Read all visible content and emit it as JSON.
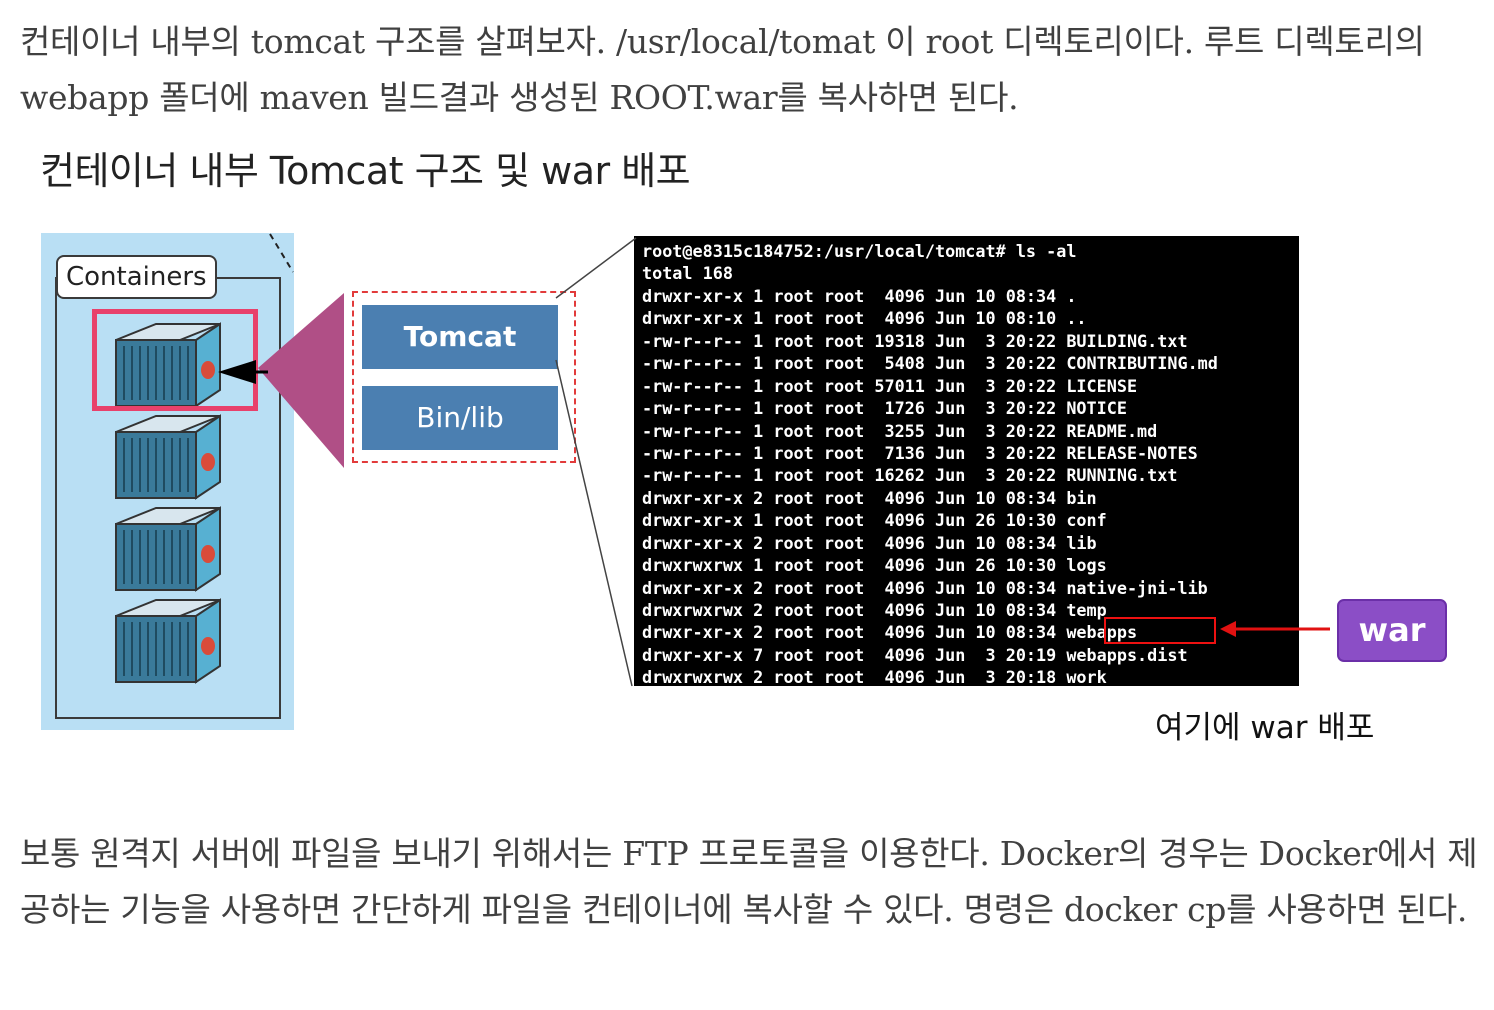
{
  "intro": "컨테이너 내부의  tomcat 구조를 살펴보자.  /usr/local/tomat 이 root 디렉토리이다. 루트 디렉토리의   webapp 폴더에 maven 빌드결과 생성된 ROOT.war를 복사하면 된다.",
  "figure": {
    "title": "컨테이너 내부 Tomcat 구조 및 war 배포",
    "containers_label": "Containers",
    "tomcat_block": "Tomcat",
    "binlib_block": "Bin/lib",
    "terminal_lines": [
      "root@e8315c184752:/usr/local/tomcat# ls -al",
      "total 168",
      "drwxr-xr-x 1 root root  4096 Jun 10 08:34 .",
      "drwxr-xr-x 1 root root  4096 Jun 10 08:10 ..",
      "-rw-r--r-- 1 root root 19318 Jun  3 20:22 BUILDING.txt",
      "-rw-r--r-- 1 root root  5408 Jun  3 20:22 CONTRIBUTING.md",
      "-rw-r--r-- 1 root root 57011 Jun  3 20:22 LICENSE",
      "-rw-r--r-- 1 root root  1726 Jun  3 20:22 NOTICE",
      "-rw-r--r-- 1 root root  3255 Jun  3 20:22 README.md",
      "-rw-r--r-- 1 root root  7136 Jun  3 20:22 RELEASE-NOTES",
      "-rw-r--r-- 1 root root 16262 Jun  3 20:22 RUNNING.txt",
      "drwxr-xr-x 2 root root  4096 Jun 10 08:34 bin",
      "drwxr-xr-x 1 root root  4096 Jun 26 10:30 conf",
      "drwxr-xr-x 2 root root  4096 Jun 10 08:34 lib",
      "drwxrwxrwx 1 root root  4096 Jun 26 10:30 logs",
      "drwxr-xr-x 2 root root  4096 Jun 10 08:34 native-jni-lib",
      "drwxrwxrwx 2 root root  4096 Jun 10 08:34 temp",
      "drwxr-xr-x 2 root root  4096 Jun 10 08:34 webapps",
      "drwxr-xr-x 7 root root  4096 Jun  3 20:19 webapps.dist",
      "drwxrwxrwx 2 root root  4096 Jun  3 20:18 work"
    ],
    "war_badge": "war",
    "deploy_caption": "여기에 war 배포"
  },
  "body": "보통 원격지 서버에 파일을 보내기 위해서는 FTP 프로토콜을 이용한다. Docker의 경우는 Docker에서 제공하는 기능을 사용하면 간단하게 파일을 컨테이너에 복사할 수 있다. 명령은 docker cp를 사용하면 된다.",
  "colors": {
    "panel_bg": "#b9dff4",
    "highlight": "#e8416b",
    "block_blue": "#4b7fb1",
    "war_purple": "#8b4ec6",
    "arrow_red": "#e11111",
    "callout_magenta": "#b04f86"
  }
}
